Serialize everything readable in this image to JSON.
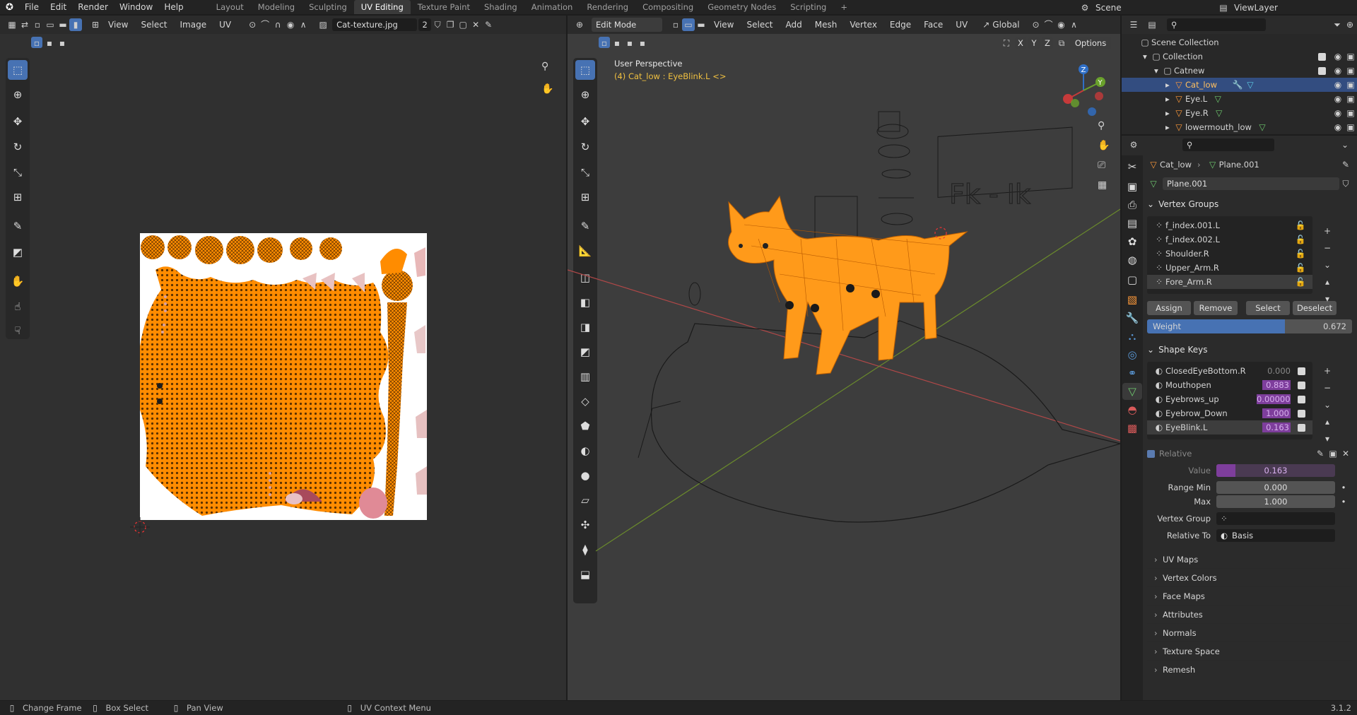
{
  "menubar": {
    "items": [
      "File",
      "Edit",
      "Render",
      "Window",
      "Help"
    ],
    "workspaces": [
      "Layout",
      "Modeling",
      "Sculpting",
      "UV Editing",
      "Texture Paint",
      "Shading",
      "Animation",
      "Rendering",
      "Compositing",
      "Geometry Nodes",
      "Scripting"
    ],
    "active": "UV Editing",
    "plus": "+",
    "scene": "Scene",
    "viewlayer": "ViewLayer"
  },
  "uv_editor": {
    "menus": [
      "View",
      "Select",
      "Image",
      "UV"
    ],
    "image_name": "Cat-texture.jpg",
    "image_users": "2"
  },
  "viewport": {
    "mode": "Edit Mode",
    "menus": [
      "View",
      "Select",
      "Add",
      "Mesh",
      "Vertex",
      "Edge",
      "Face",
      "UV"
    ],
    "orientation": "Global",
    "perspective": "User Perspective",
    "object_info": "(4) Cat_low : EyeBlink.L <>",
    "options": "Options",
    "axes": [
      "X",
      "Y",
      "Z"
    ],
    "board_text": "Fk - Ik"
  },
  "outliner": {
    "root": "Scene Collection",
    "items": [
      {
        "label": "Collection",
        "indent": 1
      },
      {
        "label": "Catnew",
        "indent": 2
      },
      {
        "label": "Cat_low",
        "indent": 3,
        "selected": true
      },
      {
        "label": "Eye.L",
        "indent": 3
      },
      {
        "label": "Eye.R",
        "indent": 3
      },
      {
        "label": "lowermouth_low",
        "indent": 3
      }
    ]
  },
  "properties": {
    "breadcrumb_obj": "Cat_low",
    "breadcrumb_mesh": "Plane.001",
    "mesh_name": "Plane.001",
    "vertex_groups_title": "Vertex Groups",
    "vertex_groups": [
      "f_index.001.L",
      "f_index.002.L",
      "Shoulder.R",
      "Upper_Arm.R",
      "Fore_Arm.R"
    ],
    "vg_buttons": [
      "Assign",
      "Remove",
      "Select",
      "Deselect"
    ],
    "weight_label": "Weight",
    "weight_value": "0.672",
    "weight_fraction": 0.672,
    "shape_keys_title": "Shape Keys",
    "shape_keys": [
      {
        "name": "ClosedEyeBottom.R",
        "value": "0.000"
      },
      {
        "name": "Mouthopen",
        "value": "0.883"
      },
      {
        "name": "Eyebrows_up",
        "value": "0.00000"
      },
      {
        "name": "Eyebrow_Down",
        "value": "1.000"
      },
      {
        "name": "EyeBlink.L",
        "value": "0.163"
      }
    ],
    "relative_label": "Relative",
    "value_label": "Value",
    "value": "0.163",
    "value_fraction": 0.163,
    "range_min_label": "Range Min",
    "range_min": "0.000",
    "max_label": "Max",
    "max": "1.000",
    "vertex_group_label": "Vertex Group",
    "relative_to_label": "Relative To",
    "relative_to": "Basis",
    "sections": [
      "UV Maps",
      "Vertex Colors",
      "Face Maps",
      "Attributes",
      "Normals",
      "Texture Space",
      "Remesh"
    ]
  },
  "statusbar": {
    "items": [
      "Change Frame",
      "Box Select",
      "Pan View",
      "UV Context Menu"
    ],
    "version": "3.1.2"
  },
  "colors": {
    "accent": "#4772b3",
    "orange": "#ff8c00",
    "shape_value": "#7e3e9c",
    "bg": "#303030"
  }
}
